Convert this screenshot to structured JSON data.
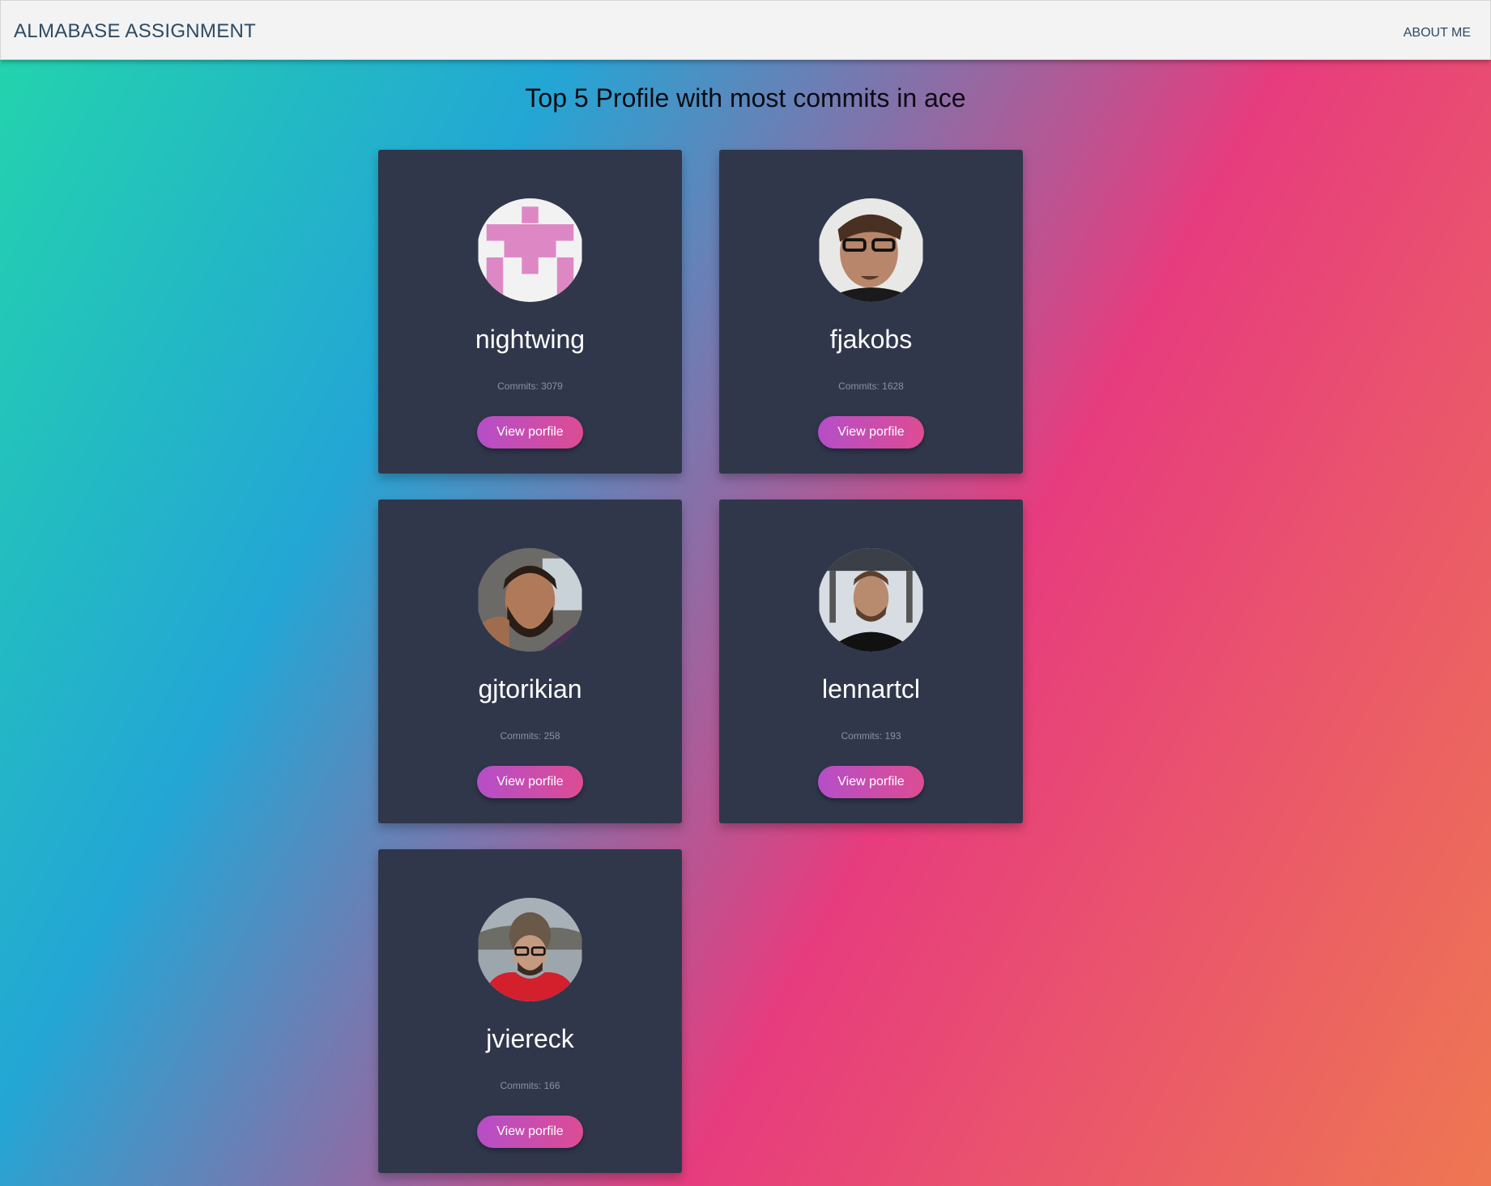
{
  "navbar": {
    "brand": "ALMABASE ASSIGNMENT",
    "about_label": "ABOUT ME"
  },
  "main": {
    "title": "Top 5 Profile with most commits in ace",
    "button_label": "View porfile",
    "profiles": [
      {
        "username": "nightwing",
        "commits_text": "Commits: 3079",
        "avatar": "identicon-avatar"
      },
      {
        "username": "fjakobs",
        "commits_text": "Commits: 1628",
        "avatar": "photo-avatar"
      },
      {
        "username": "gjtorikian",
        "commits_text": "Commits: 258",
        "avatar": "photo-avatar"
      },
      {
        "username": "lennartcl",
        "commits_text": "Commits: 193",
        "avatar": "photo-avatar"
      },
      {
        "username": "jviereck",
        "commits_text": "Commits: 166",
        "avatar": "photo-avatar"
      }
    ]
  },
  "colors": {
    "navbar_bg": "#f3f3f3",
    "card_bg": "#30374b",
    "button_gradient_start": "#b54ec8",
    "button_gradient_end": "#dd4c94",
    "identicon_color": "#dd88c4"
  }
}
